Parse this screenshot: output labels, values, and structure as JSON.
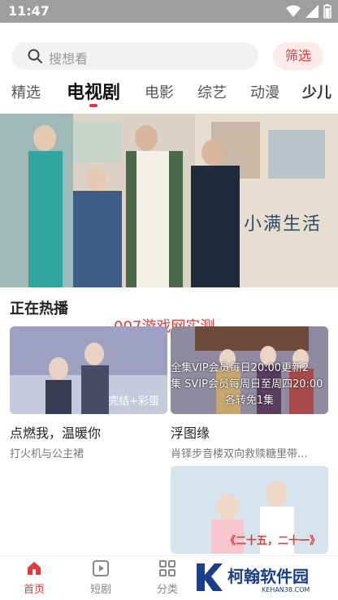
{
  "status_bar": {
    "time": "11:47"
  },
  "search": {
    "placeholder": "搜想看",
    "filter_label": "筛选"
  },
  "tabs": [
    {
      "label": "精选"
    },
    {
      "label": "电视剧"
    },
    {
      "label": "电影"
    },
    {
      "label": "综艺"
    },
    {
      "label": "动漫"
    },
    {
      "label": "少儿"
    }
  ],
  "banner": {
    "title": "小满生活"
  },
  "section": {
    "title": "正在热播"
  },
  "watermark_top": "007游戏网实测",
  "cards": [
    {
      "title": "点燃我，温暖你",
      "subtitle": "打火机与公主裙",
      "badge": "完结+彩蛋"
    },
    {
      "title": "浮图缘",
      "subtitle": "肖铎步音楼双向救赎糖里带...",
      "overlay_lines": [
        "全集VIP会员每日20:00更新2",
        "集 SVIP会员每周日至周四20:00",
        "各转免1集"
      ]
    },
    {
      "overlay": "《二十五，二十一》"
    }
  ],
  "bottom_nav": [
    {
      "label": "首页",
      "icon": "home-icon"
    },
    {
      "label": "短剧",
      "icon": "play-icon"
    },
    {
      "label": "分类",
      "icon": "grid-icon"
    }
  ],
  "brand_watermark": {
    "name": "柯翰软件园",
    "url": "KEHAN38.COM"
  },
  "colors": {
    "accent": "#e23a3a",
    "status_bar": "#9e9e9e"
  }
}
